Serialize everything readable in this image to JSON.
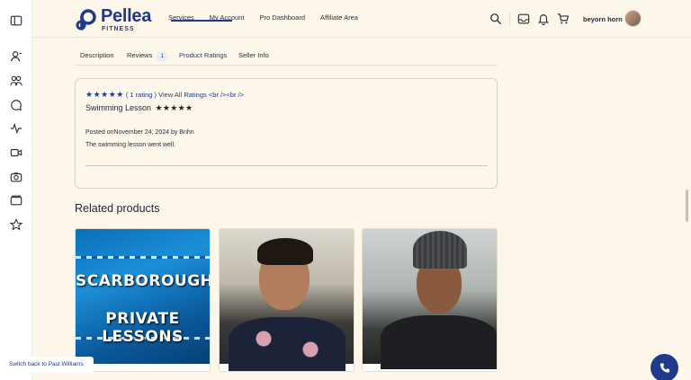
{
  "brand": {
    "name": "Pellea",
    "sub": "FITNESS",
    "color": "#1f3a8a"
  },
  "nav": [
    "Services",
    "My Account",
    "Pro Dashboard",
    "Affiliate Area"
  ],
  "user": {
    "name": "beyorn horn"
  },
  "sidebar_icons": [
    "sidebar-toggle-icon",
    "user-icon",
    "group-icon",
    "chat-icon",
    "activity-icon",
    "video-icon",
    "camera-icon",
    "folder-icon",
    "star-icon"
  ],
  "tabs": {
    "description": "Description",
    "reviews": "Reviews",
    "reviews_count": "1",
    "product_ratings": "Product Ratings",
    "seller_info": "Seller Info",
    "active": "Product Ratings"
  },
  "rating": {
    "stars": "★★★★★",
    "summary_link": "( 1 rating ) View All Ratings <br /><br />",
    "review_title": "Swimming Lesson",
    "review_stars": "★★★★★",
    "posted": "Posted onNovember 24, 2024 by Bnhn",
    "text": "The swimming lesson went well."
  },
  "related": {
    "title": "Related products",
    "products": [
      {
        "image_text_line1": "SCARBOROUGH",
        "image_text_line2": "PRIVATE LESSONS"
      },
      {},
      {}
    ]
  },
  "switch_back": "Switch back to Paul Williams"
}
